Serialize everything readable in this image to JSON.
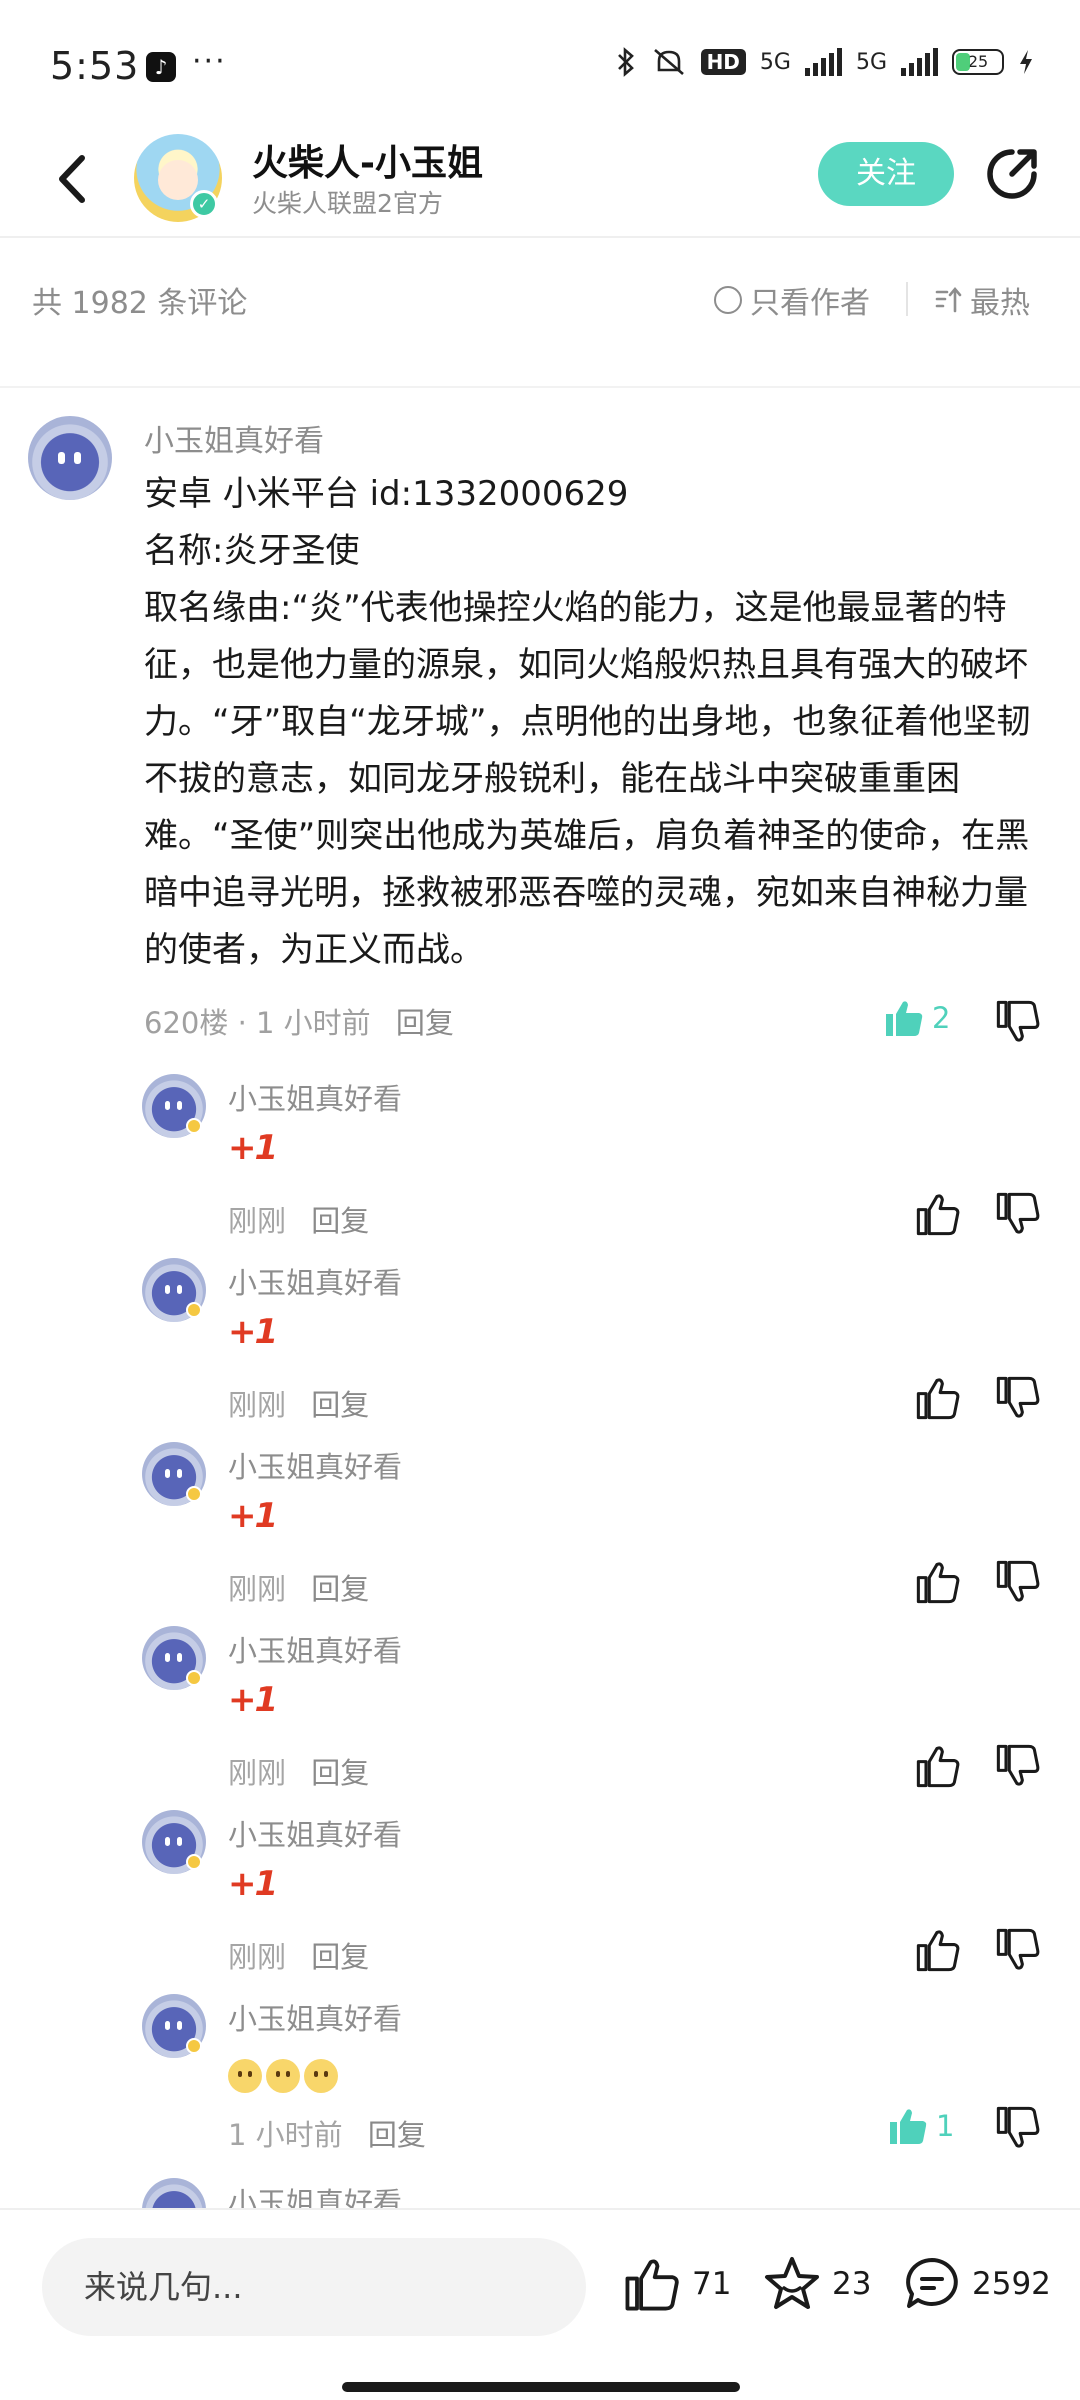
{
  "status_bar": {
    "time": "5:53",
    "app_icon": "tiktok-icon",
    "more": "···",
    "hd_label": "HD",
    "network_1": "5G",
    "network_2": "5G",
    "battery": "25"
  },
  "header": {
    "title": "火柴人-小玉姐",
    "subtitle": "火柴人联盟2官方",
    "follow_label": "关注",
    "back_icon": "chevron-left-icon",
    "share_icon": "share-icon"
  },
  "filter": {
    "count_text": "共 1982 条评论",
    "author_only": "只看作者",
    "sort_label": "最热"
  },
  "main_comment": {
    "username": "小玉姐真好看",
    "lines": [
      "安卓 小米平台 id:1332000629",
      "名称:炎牙圣使",
      "取名缘由:“炎”代表他操控火焰的能力，这是他最显著的特征，也是他力量的源泉，如同火焰般炽热且具有强大的破坏力。“牙”取自“龙牙城”，点明他的出身地，也象征着他坚韧不拔的意志，如同龙牙般锐利，能在战斗中突破重重困难。“圣使”则突出他成为英雄后，肩负着神圣的使命，在黑暗中追寻光明，拯救被邪恶吞噬的灵魂，宛如来自神秘力量的使者，为正义而战。"
    ],
    "floor_time": "620楼 · 1 小时前",
    "reply_label": "回复",
    "like_count": "2",
    "accent_color": "#4fd1bb"
  },
  "replies": [
    {
      "username": "小玉姐真好看",
      "content": "+1",
      "time": "刚刚",
      "reply_label": "回复",
      "like_count": ""
    },
    {
      "username": "小玉姐真好看",
      "content": "+1",
      "time": "刚刚",
      "reply_label": "回复",
      "like_count": ""
    },
    {
      "username": "小玉姐真好看",
      "content": "+1",
      "time": "刚刚",
      "reply_label": "回复",
      "like_count": ""
    },
    {
      "username": "小玉姐真好看",
      "content": "+1",
      "time": "刚刚",
      "reply_label": "回复",
      "like_count": ""
    },
    {
      "username": "小玉姐真好看",
      "content": "+1",
      "time": "刚刚",
      "reply_label": "回复",
      "like_count": ""
    },
    {
      "username": "小玉姐真好看",
      "content": "",
      "time": "1 小时前",
      "reply_label": "回复",
      "like_count": "1"
    },
    {
      "username": "小玉姐真好看"
    }
  ],
  "bottom_bar": {
    "input_placeholder": "来说几句...",
    "like_count": "71",
    "favorite_count": "23",
    "comment_count": "2592"
  }
}
